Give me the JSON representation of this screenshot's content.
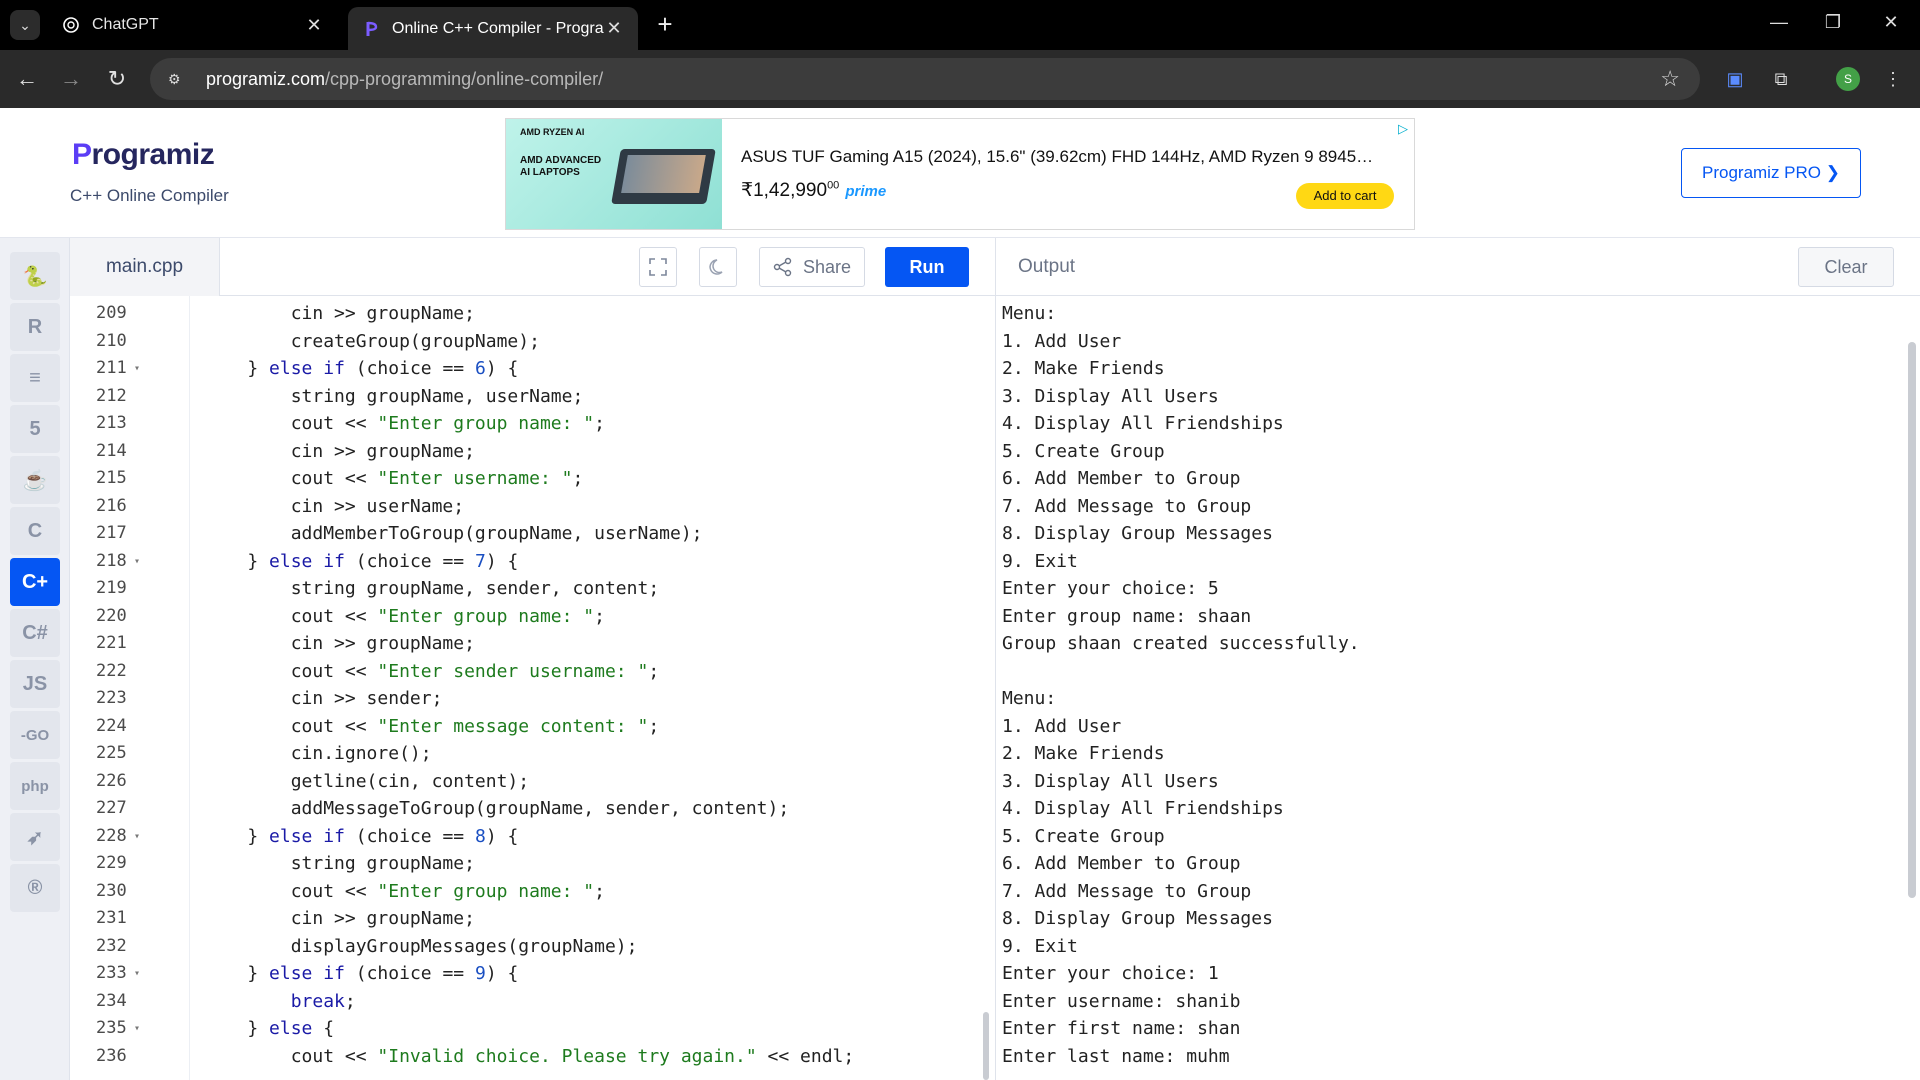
{
  "browser": {
    "tabs": [
      {
        "title": "ChatGPT",
        "active": false
      },
      {
        "title": "Online C++ Compiler - Program",
        "active": true
      }
    ],
    "url_host": "programiz.com",
    "url_path": "/cpp-programming/online-compiler/",
    "profile_initial": "S"
  },
  "site": {
    "logo_p": "P",
    "logo_rest": "rogramiz",
    "subtitle": "C++ Online Compiler",
    "pro_button": "Programiz PRO ❯",
    "ad": {
      "brand": "AMD RYZEN AI",
      "tagline": "AMD ADVANCED AI LAPTOPS",
      "title": "ASUS TUF Gaming A15 (2024), 15.6\" (39.62cm) FHD 144Hz, AMD Ryzen 9 8945…",
      "price": "₹1,42,990",
      "price_fraction": "00",
      "prime": "prime",
      "cart": "Add to cart"
    }
  },
  "rail": {
    "items": [
      {
        "name": "python-icon",
        "glyph": "🐍",
        "active": false
      },
      {
        "name": "r-lang-icon",
        "glyph": "R",
        "active": false
      },
      {
        "name": "sql-icon",
        "glyph": "≡",
        "active": false
      },
      {
        "name": "html-icon",
        "glyph": "5",
        "active": false
      },
      {
        "name": "java-icon",
        "glyph": "☕",
        "active": false
      },
      {
        "name": "c-lang-icon",
        "glyph": "C",
        "active": false
      },
      {
        "name": "cpp-lang-icon",
        "glyph": "C+",
        "active": true
      },
      {
        "name": "csharp-icon",
        "glyph": "C#",
        "active": false
      },
      {
        "name": "javascript-icon",
        "glyph": "JS",
        "active": false
      },
      {
        "name": "go-icon",
        "glyph": "-GO",
        "active": false
      },
      {
        "name": "php-icon",
        "glyph": "php",
        "active": false
      },
      {
        "name": "swift-icon",
        "glyph": "➶",
        "active": false
      },
      {
        "name": "rust-icon",
        "glyph": "®",
        "active": false
      }
    ]
  },
  "editor": {
    "file_name": "main.cpp",
    "share_label": "Share",
    "run_label": "Run",
    "lines": [
      {
        "n": "209",
        "fold": false,
        "html": "        cin >> groupName;"
      },
      {
        "n": "210",
        "fold": false,
        "html": "        createGroup(groupName);"
      },
      {
        "n": "211",
        "fold": true,
        "html": "    } <k>else</k> <k>if</k> (choice == <m>6</m>) {"
      },
      {
        "n": "212",
        "fold": false,
        "html": "        string groupName, userName;"
      },
      {
        "n": "213",
        "fold": false,
        "html": "        cout << <s>\"Enter group name: \"</s>;"
      },
      {
        "n": "214",
        "fold": false,
        "html": "        cin >> groupName;"
      },
      {
        "n": "215",
        "fold": false,
        "html": "        cout << <s>\"Enter username: \"</s>;"
      },
      {
        "n": "216",
        "fold": false,
        "html": "        cin >> userName;"
      },
      {
        "n": "217",
        "fold": false,
        "html": "        addMemberToGroup(groupName, userName);"
      },
      {
        "n": "218",
        "fold": true,
        "html": "    } <k>else</k> <k>if</k> (choice == <m>7</m>) {"
      },
      {
        "n": "219",
        "fold": false,
        "html": "        string groupName, sender, content;"
      },
      {
        "n": "220",
        "fold": false,
        "html": "        cout << <s>\"Enter group name: \"</s>;"
      },
      {
        "n": "221",
        "fold": false,
        "html": "        cin >> groupName;"
      },
      {
        "n": "222",
        "fold": false,
        "html": "        cout << <s>\"Enter sender username: \"</s>;"
      },
      {
        "n": "223",
        "fold": false,
        "html": "        cin >> sender;"
      },
      {
        "n": "224",
        "fold": false,
        "html": "        cout << <s>\"Enter message content: \"</s>;"
      },
      {
        "n": "225",
        "fold": false,
        "html": "        cin.ignore();"
      },
      {
        "n": "226",
        "fold": false,
        "html": "        getline(cin, content);"
      },
      {
        "n": "227",
        "fold": false,
        "html": "        addMessageToGroup(groupName, sender, content);"
      },
      {
        "n": "228",
        "fold": true,
        "html": "    } <k>else</k> <k>if</k> (choice == <m>8</m>) {"
      },
      {
        "n": "229",
        "fold": false,
        "html": "        string groupName;"
      },
      {
        "n": "230",
        "fold": false,
        "html": "        cout << <s>\"Enter group name: \"</s>;"
      },
      {
        "n": "231",
        "fold": false,
        "html": "        cin >> groupName;"
      },
      {
        "n": "232",
        "fold": false,
        "html": "        displayGroupMessages(groupName);"
      },
      {
        "n": "233",
        "fold": true,
        "html": "    } <k>else</k> <k>if</k> (choice == <m>9</m>) {"
      },
      {
        "n": "234",
        "fold": false,
        "html": "        <k>break</k>;"
      },
      {
        "n": "235",
        "fold": true,
        "html": "    } <k>else</k> {"
      },
      {
        "n": "236",
        "fold": false,
        "html": "        cout << <s>\"Invalid choice. Please try again.\"</s> << endl;"
      }
    ]
  },
  "output": {
    "title": "Output",
    "clear_label": "Clear",
    "lines": [
      "Menu:",
      "1. Add User",
      "2. Make Friends",
      "3. Display All Users",
      "4. Display All Friendships",
      "5. Create Group",
      "6. Add Member to Group",
      "7. Add Message to Group",
      "8. Display Group Messages",
      "9. Exit",
      "Enter your choice: 5",
      "Enter group name: shaan",
      "Group shaan created successfully.",
      "",
      "Menu:",
      "1. Add User",
      "2. Make Friends",
      "3. Display All Users",
      "4. Display All Friendships",
      "5. Create Group",
      "6. Add Member to Group",
      "7. Add Message to Group",
      "8. Display Group Messages",
      "9. Exit",
      "Enter your choice: 1",
      "Enter username: shanib",
      "Enter first name: shan",
      "Enter last name: muhm"
    ]
  },
  "colors": {
    "accent": "#0556f3",
    "keyword": "#1a1aa6",
    "string": "#1e7b1e"
  }
}
